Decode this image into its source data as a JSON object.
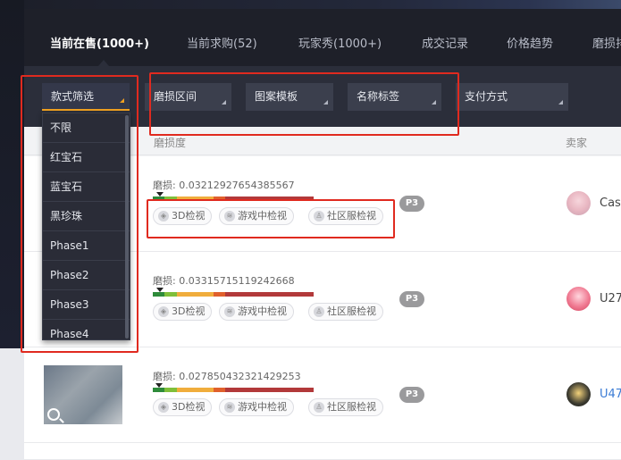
{
  "tabs": [
    {
      "label": "当前在售(1000+)",
      "active": true
    },
    {
      "label": "当前求购(52)",
      "active": false
    },
    {
      "label": "玩家秀(1000+)",
      "active": false
    },
    {
      "label": "成交记录",
      "active": false
    },
    {
      "label": "价格趋势",
      "active": false
    },
    {
      "label": "磨损排",
      "active": false
    }
  ],
  "filters": [
    {
      "label": "款式筛选",
      "active": true
    },
    {
      "label": "磨损区间",
      "active": false
    },
    {
      "label": "图案模板",
      "active": false
    },
    {
      "label": "名称标签",
      "active": false
    },
    {
      "label": "支付方式",
      "active": false
    }
  ],
  "dropdown": {
    "options": [
      "不限",
      "红宝石",
      "蓝宝石",
      "黑珍珠",
      "Phase1",
      "Phase2",
      "Phase3",
      "Phase4"
    ]
  },
  "table": {
    "col_wear": "磨损度",
    "col_seller": "卖家"
  },
  "rows": [
    {
      "wear_text": "磨损: 0.03212927654385567",
      "wear_value": 0.03212927654385567,
      "badge": "P3",
      "seller": "Cas",
      "buttons": [
        "3D检视",
        "游戏中检视",
        "社区服检视"
      ]
    },
    {
      "wear_text": "磨损: 0.03315715119242668",
      "wear_value": 0.03315715119242668,
      "badge": "P3",
      "seller": "U27",
      "buttons": [
        "3D检视",
        "游戏中检视",
        "社区服检视"
      ]
    },
    {
      "wear_text": "磨损: 0.027850432321429253",
      "wear_value": 0.027850432321429253,
      "badge": "P3",
      "seller": "U47",
      "buttons": [
        "3D检视",
        "游戏中检视",
        "社区服检视"
      ]
    }
  ],
  "colors": {
    "accent": "#f0a020",
    "annotation": "#e02a1f",
    "wear_fn": "#2e8b3a",
    "wear_mw": "#7fbf3a",
    "wear_ft": "#f0ad3c",
    "wear_ww": "#e0602c",
    "wear_bs": "#b2393a"
  }
}
